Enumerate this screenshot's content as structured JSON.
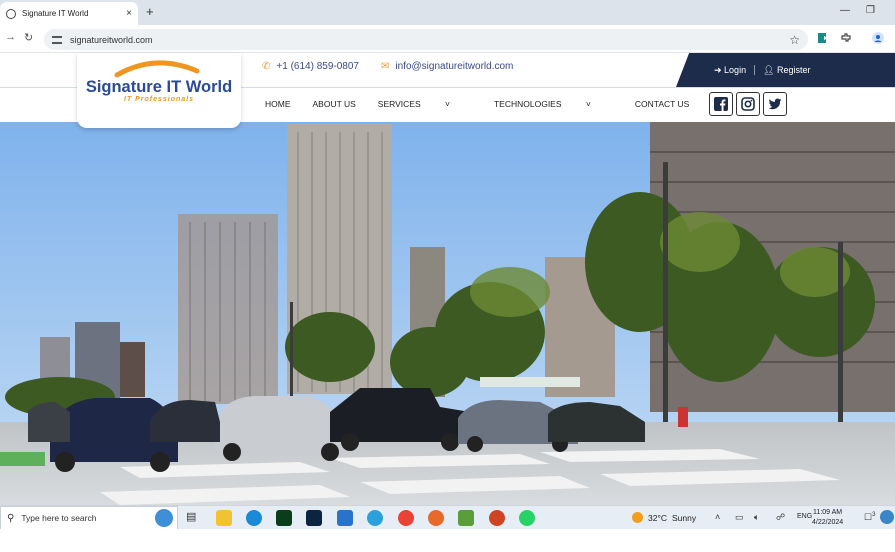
{
  "browser": {
    "tab_title": "Signature IT World",
    "url": "signatureitworld.com",
    "new_tab": "+",
    "tab_close": "×"
  },
  "site": {
    "logo_name": "Signature IT World",
    "logo_tagline": "IT Professionals",
    "phone": "+1 (614) 859-0807",
    "email": "info@signatureitworld.com",
    "login_label": "Login",
    "register_label": "Register",
    "nav": [
      "HOME",
      "ABOUT US",
      "SERVICES",
      "TECHNOLOGIES",
      "CONTACT US"
    ],
    "social": [
      "facebook-icon",
      "instagram-icon",
      "twitter-icon"
    ],
    "colors": {
      "brand_navy": "#1d2c4a",
      "brand_blue": "#2a4b97",
      "brand_orange": "#f0951e"
    }
  },
  "taskbar": {
    "search_placeholder": "Type here to search",
    "weather_temp": "32°C",
    "weather_desc": "Sunny",
    "lang": "ENG",
    "time": "11:09 AM",
    "date": "4/22/2024",
    "notification_count": "3"
  }
}
